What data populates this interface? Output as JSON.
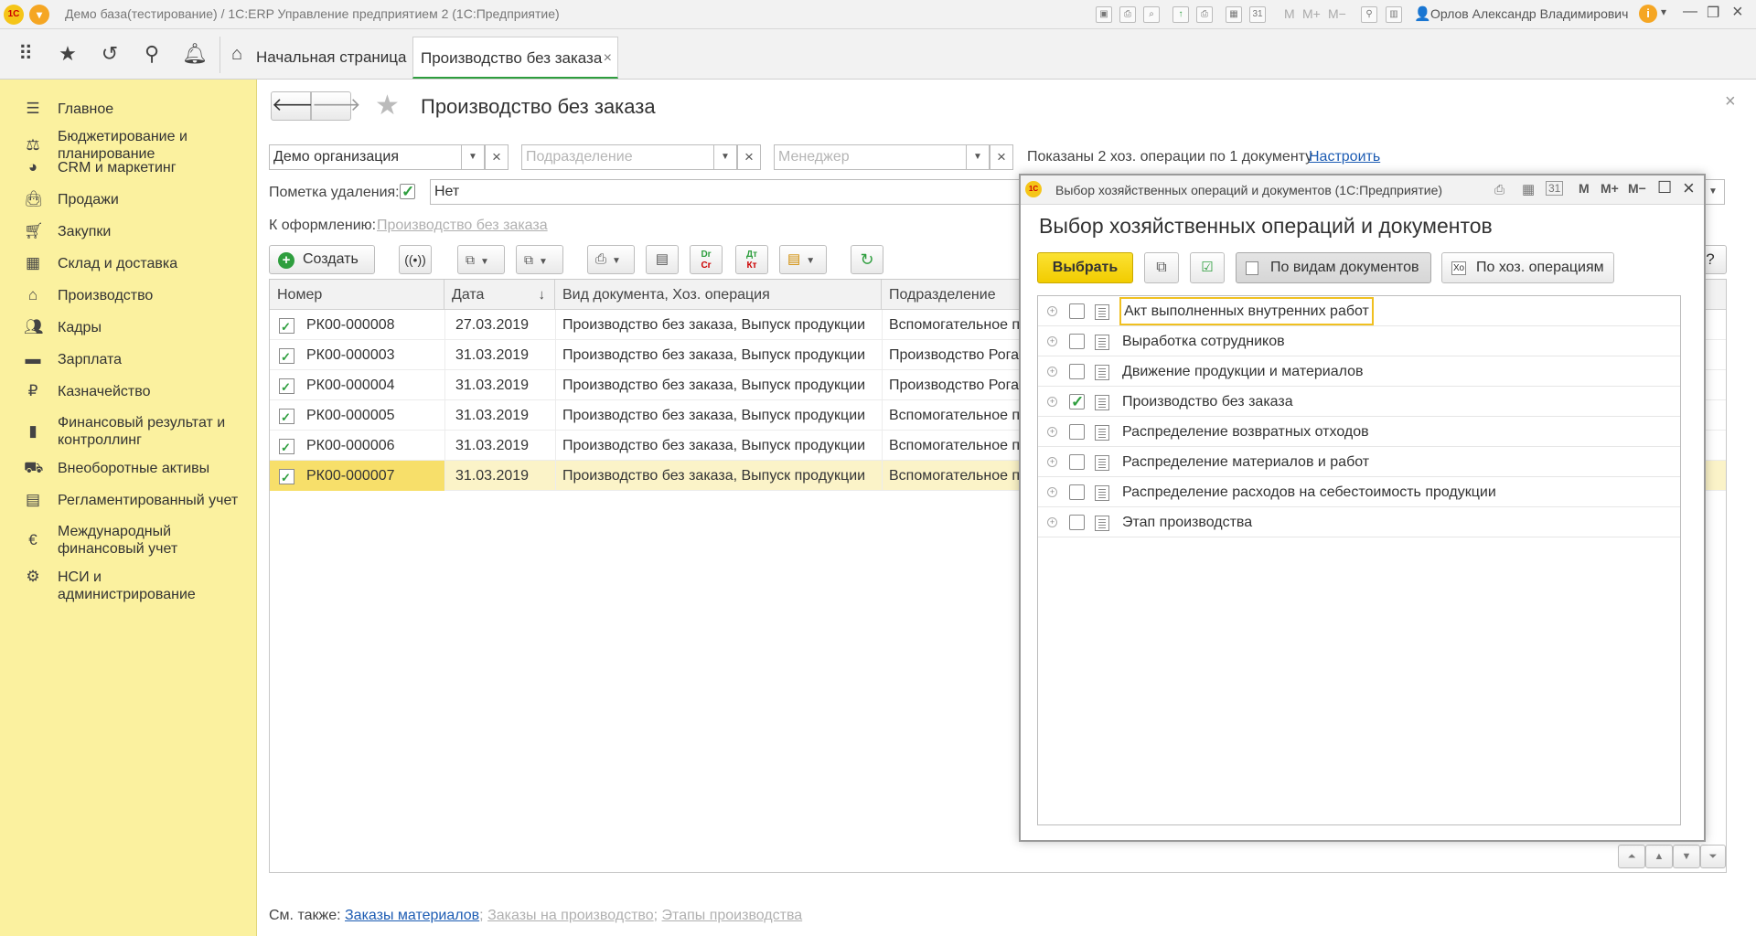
{
  "window": {
    "title": "Демо база(тестирование) / 1С:ERP Управление предприятием 2  (1С:Предприятие)",
    "user": "Орлов Александр Владимирович",
    "memory_buttons": [
      "M",
      "M+",
      "M−"
    ]
  },
  "navbar": {
    "home_tab": "Начальная страница",
    "active_tab": "Производство без заказа"
  },
  "sidebar": {
    "items": [
      {
        "label": "Главное",
        "icon": "menu-lines-icon"
      },
      {
        "label": "Бюджетирование и планирование",
        "icon": "budget-icon"
      },
      {
        "label": "CRM и маркетинг",
        "icon": "pie-icon"
      },
      {
        "label": "Продажи",
        "icon": "bag-icon"
      },
      {
        "label": "Закупки",
        "icon": "cart-icon"
      },
      {
        "label": "Склад и доставка",
        "icon": "warehouse-icon"
      },
      {
        "label": "Производство",
        "icon": "factory-icon"
      },
      {
        "label": "Кадры",
        "icon": "people-icon"
      },
      {
        "label": "Зарплата",
        "icon": "salary-icon"
      },
      {
        "label": "Казначейство",
        "icon": "ruble-icon"
      },
      {
        "label": "Финансовый результат и контроллинг",
        "icon": "chart-icon"
      },
      {
        "label": "Внеоборотные активы",
        "icon": "truck-icon"
      },
      {
        "label": "Регламентированный учет",
        "icon": "document-icon"
      },
      {
        "label": "Международный финансовый учет",
        "icon": "euro-icon"
      },
      {
        "label": "НСИ и администрирование",
        "icon": "gear-icon"
      }
    ]
  },
  "form": {
    "title": "Производство без заказа",
    "filters": {
      "organization": "Демо организация",
      "department_placeholder": "Подразделение",
      "manager_placeholder": "Менеджер",
      "summary": "Показаны 2 хоз. операции по 1 документу",
      "configure_link": "Настроить"
    },
    "deletion_mark_label": "Пометка удаления:",
    "deletion_mark_value": "Нет",
    "to_process_label": "К оформлению:",
    "to_process_link": "Производство без заказа",
    "create_button": "Создать",
    "help_button": "?",
    "table": {
      "columns": [
        "Номер",
        "Дата",
        "Вид документа, Хоз. операция",
        "Подразделение"
      ],
      "rows": [
        {
          "number": "РК00-000008",
          "date": "27.03.2019",
          "kind": "Производство без заказа, Выпуск продукции",
          "dept": "Вспомогательное п"
        },
        {
          "number": "РК00-000003",
          "date": "31.03.2019",
          "kind": "Производство без заказа, Выпуск продукции",
          "dept": "Производство Рога"
        },
        {
          "number": "РК00-000004",
          "date": "31.03.2019",
          "kind": "Производство без заказа, Выпуск продукции",
          "dept": "Производство Рога"
        },
        {
          "number": "РК00-000005",
          "date": "31.03.2019",
          "kind": "Производство без заказа, Выпуск продукции",
          "dept": "Вспомогательное п"
        },
        {
          "number": "РК00-000006",
          "date": "31.03.2019",
          "kind": "Производство без заказа, Выпуск продукции",
          "dept": "Вспомогательное п"
        },
        {
          "number": "РК00-000007",
          "date": "31.03.2019",
          "kind": "Производство без заказа, Выпуск продукции",
          "dept": "Вспомогательное п",
          "selected": true
        }
      ]
    },
    "see_also": {
      "label": "См. также:",
      "links": [
        "Заказы материалов",
        "Заказы на производство",
        "Этапы производства"
      ]
    }
  },
  "dialog": {
    "window_title": "Выбор хозяйственных операций и документов  (1С:Предприятие)",
    "heading": "Выбор хозяйственных операций и документов",
    "select_button": "Выбрать",
    "by_doc_types": "По видам документов",
    "by_operations": "По хоз. операциям",
    "by_operations_icon_text": "Хо",
    "items": [
      {
        "label": "Акт выполненных внутренних работ",
        "checked": false,
        "focused": true
      },
      {
        "label": "Выработка сотрудников",
        "checked": false
      },
      {
        "label": "Движение продукции и материалов",
        "checked": false
      },
      {
        "label": "Производство без заказа",
        "checked": true
      },
      {
        "label": "Распределение возвратных отходов",
        "checked": false
      },
      {
        "label": "Распределение материалов и работ",
        "checked": false
      },
      {
        "label": "Распределение расходов на себестоимость продукции",
        "checked": false
      },
      {
        "label": "Этап производства",
        "checked": false
      }
    ]
  },
  "colors": {
    "sidebar_bg": "#fbf19f",
    "accent_green": "#2e9e3e",
    "primary_button": "#f5d20a",
    "link_blue": "#1d5cb3",
    "selected_row": "#fbf3c8"
  }
}
